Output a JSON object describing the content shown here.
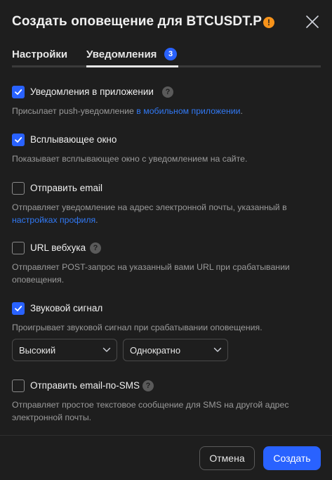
{
  "dialog": {
    "title": "Создать оповещение для BTCUSDT.P",
    "warning_icon_glyph": "!",
    "accent_color": "#2962ff",
    "warning_color": "#f7931a"
  },
  "tabs": {
    "settings_label": "Настройки",
    "notifications_label": "Уведомления",
    "notifications_count": "3",
    "active": "notifications"
  },
  "options": {
    "app": {
      "label": "Уведомления в приложении",
      "checked": true,
      "desc_prefix": "Присылает push-уведомление ",
      "desc_link": "в мобильном приложении",
      "desc_suffix": "."
    },
    "popup": {
      "label": "Всплывающее окно",
      "checked": true,
      "desc": "Показывает всплывающее окно с уведомлением на сайте."
    },
    "email": {
      "label": "Отправить email",
      "checked": false,
      "desc_prefix": "Отправляет уведомление на адрес электронной почты, указанный в ",
      "desc_link": "настройках профиля",
      "desc_suffix": "."
    },
    "webhook": {
      "label": "URL вебхука",
      "checked": false,
      "desc": "Отправляет POST-запрос на указанный вами URL при срабатывании оповещения."
    },
    "sound": {
      "label": "Звуковой сигнал",
      "checked": true,
      "desc": "Проигрывает звуковой сигнал при срабатывании оповещения.",
      "volume_value": "Высокий",
      "repeat_value": "Однократно"
    },
    "email_sms": {
      "label": "Отправить email-по-SMS",
      "checked": false,
      "desc": "Отправляет простое текстовое сообщение для SMS на другой адрес электронной почты."
    }
  },
  "help_glyph": "?",
  "footer": {
    "cancel_label": "Отмена",
    "create_label": "Создать"
  }
}
